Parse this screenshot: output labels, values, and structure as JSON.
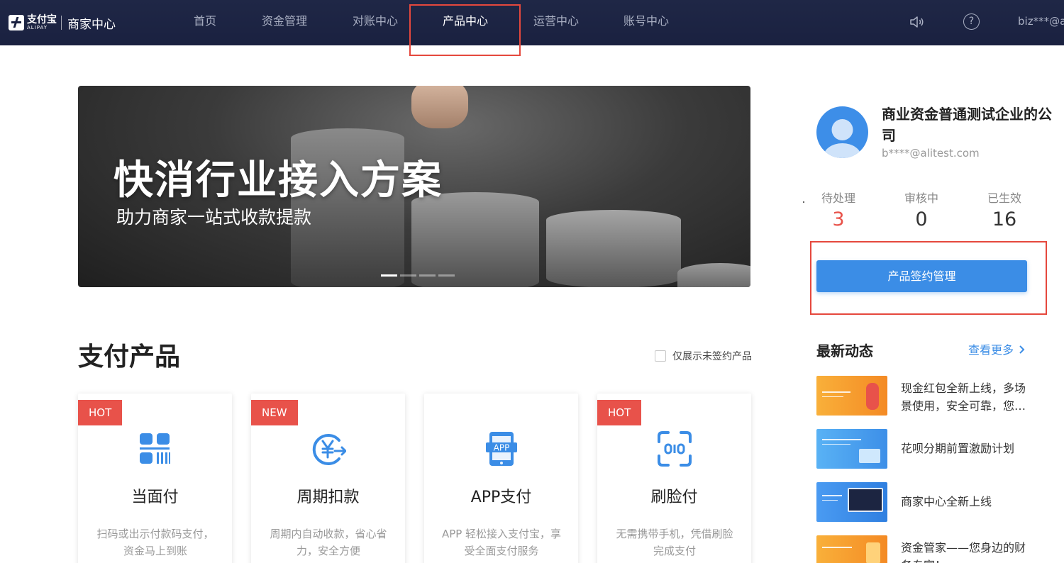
{
  "brand": {
    "logo_cn": "支付宝",
    "logo_en": "ALIPAY",
    "title": "商家中心"
  },
  "nav": {
    "items": [
      "首页",
      "资金管理",
      "对账中心",
      "产品中心",
      "运营中心",
      "账号中心"
    ],
    "active_index": 3,
    "help_glyph": "?",
    "account": "biz***@a"
  },
  "banner": {
    "title": "快消行业接入方案",
    "subtitle": "助力商家一站式收款提款",
    "slides_count": 4,
    "active_slide": 0
  },
  "section": {
    "title": "支付产品",
    "filter_label": "仅展示未签约产品",
    "filter_checked": false
  },
  "products": [
    {
      "badge": "HOT",
      "name": "当面付",
      "desc": "扫码或出示付款码支付，资金马上到账",
      "icon": "qrcode-scan-icon"
    },
    {
      "badge": "NEW",
      "name": "周期扣款",
      "desc": "周期内自动收款，省心省力，安全方便",
      "icon": "yuan-cycle-icon"
    },
    {
      "badge": "",
      "name": "APP支付",
      "desc": "APP 轻松接入支付宝，享受全面支付服务",
      "icon": "app-phone-icon"
    },
    {
      "badge": "HOT",
      "name": "刷脸付",
      "desc": "无需携带手机，凭借刷脸完成支付",
      "icon": "face-scan-icon"
    }
  ],
  "profile": {
    "company": "商业资金普通测试企业的公司",
    "email": "b****@alitest.com",
    "stats": [
      {
        "label": "待处理",
        "value": "3"
      },
      {
        "label": "审核中",
        "value": "0"
      },
      {
        "label": "已生效",
        "value": "16"
      }
    ],
    "button": "产品签约管理"
  },
  "news": {
    "title": "最新动态",
    "more": "查看更多",
    "items": [
      {
        "text": "现金红包全新上线，多场景使用，安全可靠，您…",
        "thumb_color": "#f7a12c"
      },
      {
        "text": "花呗分期前置激励计划",
        "thumb_color": "#4aa3f0"
      },
      {
        "text": "商家中心全新上线",
        "thumb_color": "#3e8ff0"
      },
      {
        "text": "资金管家——您身边的财务专家！",
        "thumb_color": "#f7a12c"
      }
    ]
  },
  "colors": {
    "nav_bg": "#1c2541",
    "accent": "#3b8de6",
    "hot_badge": "#e8524a",
    "highlight_box": "#e5483d"
  }
}
